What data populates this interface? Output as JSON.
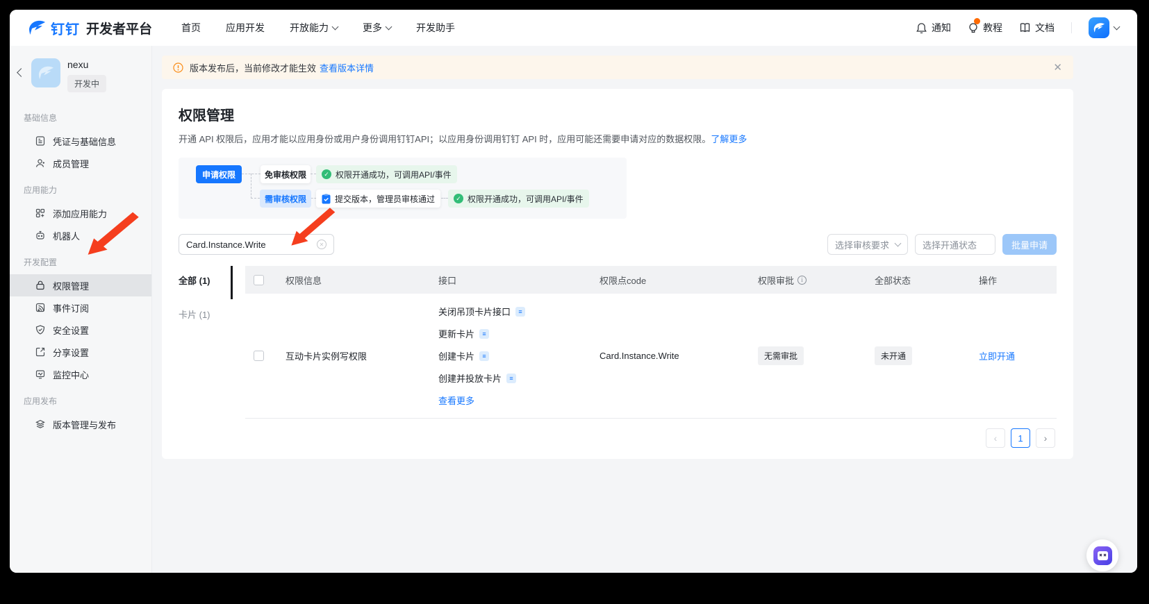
{
  "topnav": {
    "brand_cn": "钉钉",
    "brand_title": "开发者平台",
    "items": [
      {
        "label": "首页"
      },
      {
        "label": "应用开发"
      },
      {
        "label": "开放能力"
      },
      {
        "label": "更多"
      },
      {
        "label": "开发助手"
      }
    ],
    "notify": "通知",
    "tutorial": "教程",
    "docs": "文档"
  },
  "sidebar": {
    "app_name": "nexu",
    "app_status": "开发中",
    "groups": [
      {
        "label": "基础信息",
        "items": [
          {
            "label": "凭证与基础信息"
          },
          {
            "label": "成员管理"
          }
        ]
      },
      {
        "label": "应用能力",
        "items": [
          {
            "label": "添加应用能力"
          },
          {
            "label": "机器人"
          }
        ]
      },
      {
        "label": "开发配置",
        "items": [
          {
            "label": "权限管理"
          },
          {
            "label": "事件订阅"
          },
          {
            "label": "安全设置"
          },
          {
            "label": "分享设置"
          },
          {
            "label": "监控中心"
          }
        ]
      },
      {
        "label": "应用发布",
        "items": [
          {
            "label": "版本管理与发布"
          }
        ]
      }
    ]
  },
  "banner": {
    "text": "版本发布后，当前修改才能生效",
    "link": "查看版本详情"
  },
  "page": {
    "title": "权限管理",
    "desc": "开通 API 权限后，应用才能以应用身份或用户身份调用钉钉API；以应用身份调用钉钉 API 时，应用可能还需要申请对应的数据权限。",
    "learn_more": "了解更多"
  },
  "flow": {
    "apply": "申请权限",
    "no_review": "免审核权限",
    "success_1": "权限开通成功，可调用API/事件",
    "need_review": "需审核权限",
    "submit": "提交版本，管理员审核通过",
    "success_2": "权限开通成功，可调用API/事件"
  },
  "toolbar": {
    "search_value": "Card.Instance.Write",
    "review_filter": "选择审核要求",
    "status_filter": "选择开通状态",
    "batch_apply": "批量申请"
  },
  "tabs": [
    {
      "label": "全部 (1)"
    },
    {
      "label": "卡片 (1)"
    }
  ],
  "table": {
    "headers": {
      "info": "权限信息",
      "api": "接口",
      "code": "权限点code",
      "review": "权限审批",
      "status": "全部状态",
      "action": "操作"
    },
    "row": {
      "name": "互动卡片实例写权限",
      "apis": [
        "关闭吊顶卡片接口",
        "更新卡片",
        "创建卡片",
        "创建并投放卡片"
      ],
      "more_link": "查看更多",
      "code": "Card.Instance.Write",
      "review": "无需审批",
      "status": "未开通",
      "action": "立即开通"
    }
  },
  "pagination": {
    "page": "1"
  },
  "colors": {
    "accent": "#1677ff",
    "warning": "#fa8c16",
    "success": "#32bd77",
    "annotation_red": "#f53e1e"
  }
}
